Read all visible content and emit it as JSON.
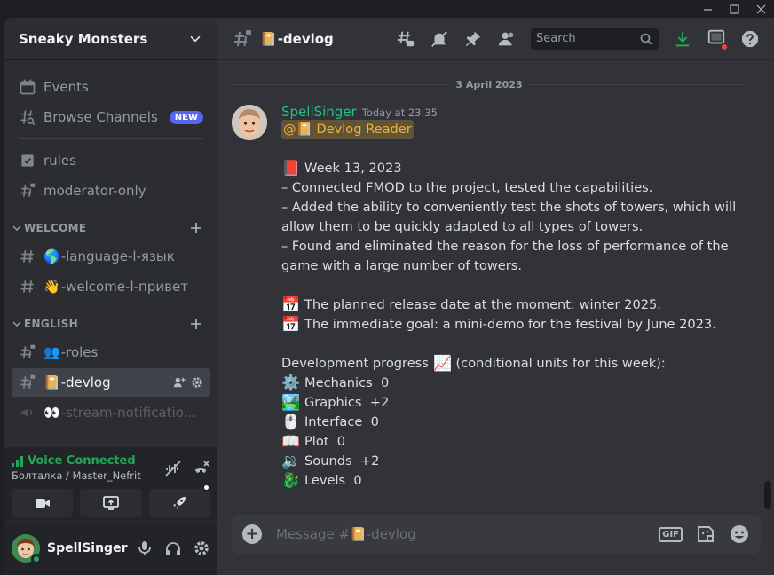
{
  "window": {
    "controls": [
      "minimize-icon",
      "maximize-icon",
      "close-icon"
    ]
  },
  "server": {
    "name": "Sneaky Monsters"
  },
  "sidebar": {
    "top_items": [
      {
        "label": "Events",
        "icon": "calendar-icon"
      },
      {
        "label": "Browse Channels",
        "icon": "browse-channels-icon",
        "badge": "NEW"
      }
    ],
    "channels_top": [
      {
        "label": "rules",
        "icon": "checkbox-icon"
      },
      {
        "label": "moderator-only",
        "icon": "locked-hash-icon"
      }
    ],
    "categories": [
      {
        "name": "WELCOME",
        "channels": [
          {
            "emoji": "🌎",
            "label": "-language-l-язык"
          },
          {
            "emoji": "👋",
            "label": "-welcome-l-привет"
          }
        ]
      },
      {
        "name": "ENGLISH",
        "channels": [
          {
            "emoji": "👥",
            "label": "-roles"
          },
          {
            "emoji": "📔",
            "label": "-devlog",
            "active": true
          },
          {
            "emoji": "👀",
            "label": "-stream-notificatio..."
          }
        ]
      }
    ]
  },
  "voice": {
    "status": "Voice Connected",
    "location": "Болталка / Master_Nefrit"
  },
  "user": {
    "name": "SpellSinger"
  },
  "channel": {
    "emoji": "📔",
    "name": "-devlog"
  },
  "search": {
    "placeholder": "Search"
  },
  "date_divider": "3 April 2023",
  "message": {
    "author": "SpellSinger",
    "timestamp": "Today at 23:35",
    "mention_emoji": "📔",
    "mention_text": " Devlog Reader",
    "mention_prefix": "@",
    "week_emoji": "📕",
    "week_title": "Week 13, 2023",
    "items": [
      "– Connected FMOD to the project, tested the capabilities.",
      "– Added the ability to conveniently test the shots of towers, which will allow them to be quickly adapted to all types of towers.",
      "– Found and eliminated the reason for the loss of performance of the game with a large number of towers."
    ],
    "release_emoji": "📅",
    "release": "The planned release date at the moment: winter 2025.",
    "goal_emoji": "📅",
    "goal": "The immediate goal: a mini-demo for the festival by June 2023.",
    "progress_title": "Development progress",
    "progress_emoji": "📈",
    "progress_note": " (conditional units for this week):",
    "progress": [
      {
        "emoji": "⚙️",
        "label": "Mechanics",
        "value": "0"
      },
      {
        "emoji": "🏞️",
        "label": "Graphics",
        "value": "+2"
      },
      {
        "emoji": "🖱️",
        "label": "Interface",
        "value": "0"
      },
      {
        "emoji": "📖",
        "label": "Plot",
        "value": "0"
      },
      {
        "emoji": "🔉",
        "label": "Sounds",
        "value": "+2"
      },
      {
        "emoji": "🐉",
        "label": "Levels",
        "value": "0"
      }
    ]
  },
  "composer": {
    "placeholder": "Message #📔-devlog",
    "gif_label": "GIF"
  }
}
